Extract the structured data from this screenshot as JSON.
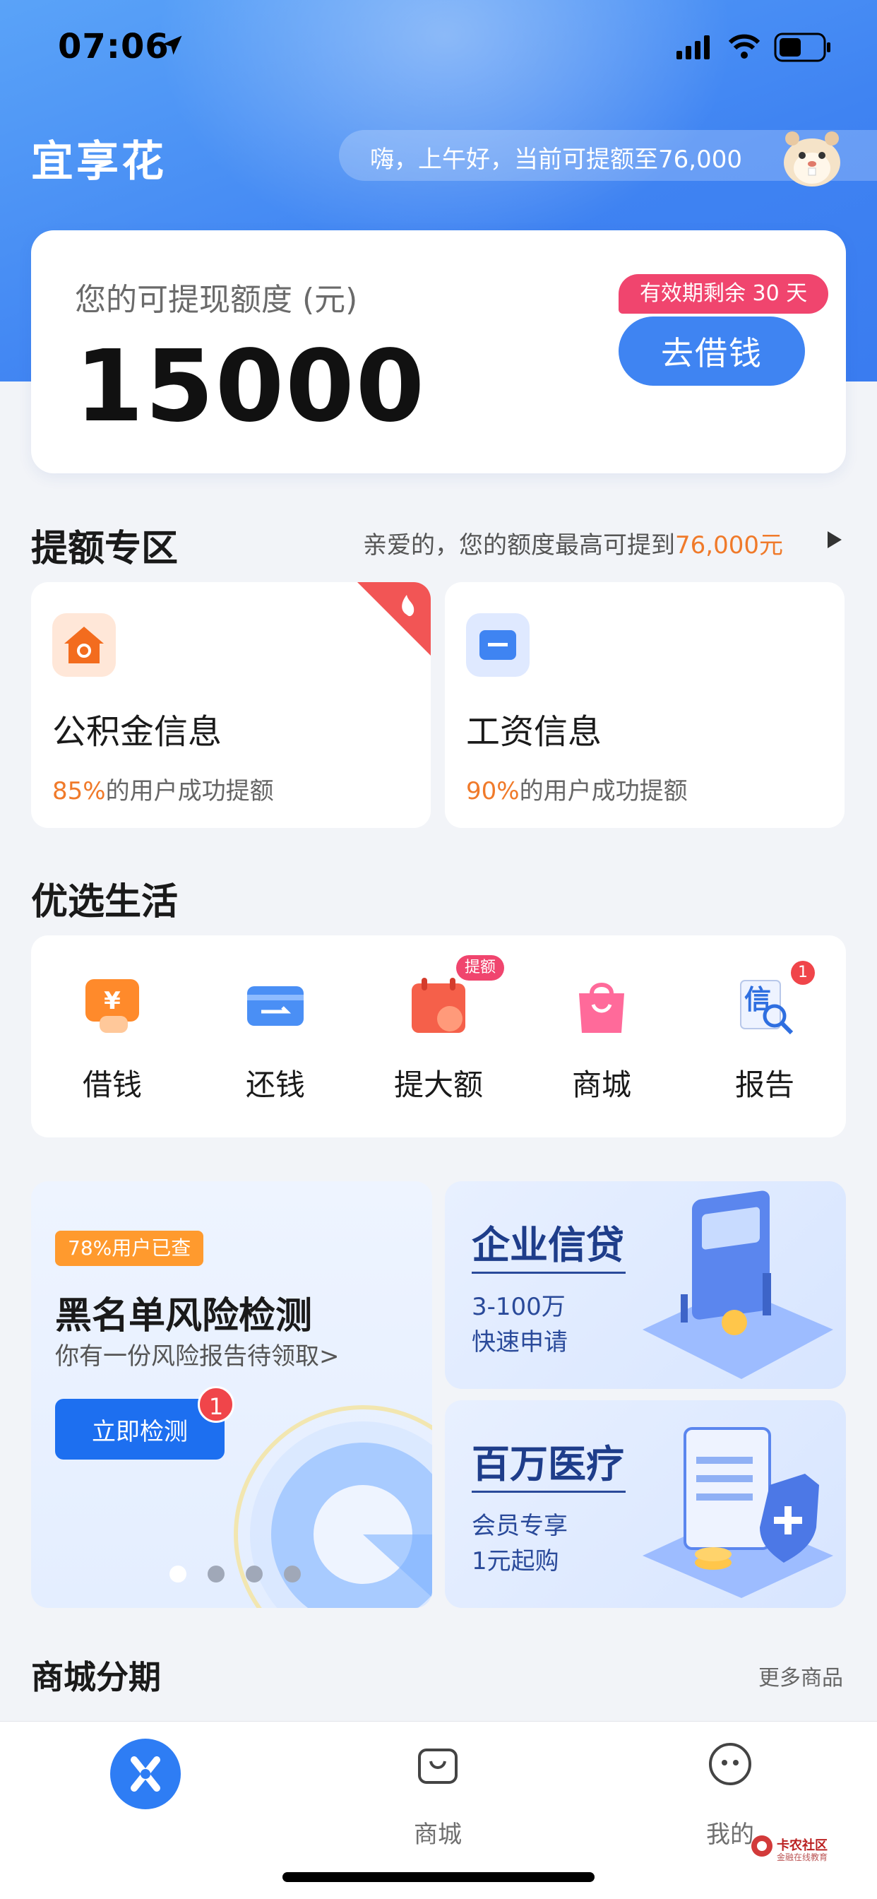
{
  "status_bar": {
    "time": "07:06"
  },
  "header": {
    "app_title": "宜享花",
    "greeting": "嗨，上午好，当前可提额至76,000"
  },
  "credit": {
    "label": "您的可提现额度 (元)",
    "amount": "15000",
    "validity": "有效期剩余 30 天",
    "borrow_button": "去借钱"
  },
  "limit_zone": {
    "title": "提额专区",
    "subtitle_prefix": "亲爱的，您的额度最高可提到",
    "subtitle_amount": "76,000元",
    "cards": [
      {
        "name": "公积金信息",
        "percent": "85%",
        "rate_text": "的用户成功提额",
        "icon": "house-icon",
        "hot": true
      },
      {
        "name": "工资信息",
        "percent": "90%",
        "rate_text": "的用户成功提额",
        "icon": "card-icon",
        "hot": false
      }
    ]
  },
  "lifestyle": {
    "title": "优选生活",
    "items": [
      {
        "label": "借钱",
        "icon": "yen-hand-icon"
      },
      {
        "label": "还钱",
        "icon": "repay-card-icon"
      },
      {
        "label": "提大额",
        "icon": "calendar-icon",
        "badge": "提额"
      },
      {
        "label": "商城",
        "icon": "shopping-bag-icon"
      },
      {
        "label": "报告",
        "icon": "credit-report-icon",
        "badge": "1"
      }
    ]
  },
  "promos": {
    "blacklist": {
      "tag": "78%用户已查",
      "title": "黑名单风险检测",
      "subtitle": "你有一份风险报告待领取>",
      "button": "立即检测",
      "badge": "1"
    },
    "enterprise": {
      "title": "企业信贷",
      "line1": "3-100万",
      "line2": "快速申请"
    },
    "medical": {
      "title": "百万医疗",
      "line1": "会员专享",
      "line2": "1元起购"
    }
  },
  "mall": {
    "title": "商城分期",
    "more": "更多商品"
  },
  "tab_bar": {
    "tabs": [
      {
        "label": "",
        "icon": "home-logo-icon"
      },
      {
        "label": "商城",
        "icon": "bag-tab-icon"
      },
      {
        "label": "我的",
        "icon": "smile-face-icon"
      }
    ]
  },
  "watermark": {
    "line1": "卡农社区",
    "line2": "金融在线教育"
  },
  "colors": {
    "primary": "#3f84f2",
    "accent_orange": "#f07a2a",
    "badge_red": "#f0456e"
  }
}
